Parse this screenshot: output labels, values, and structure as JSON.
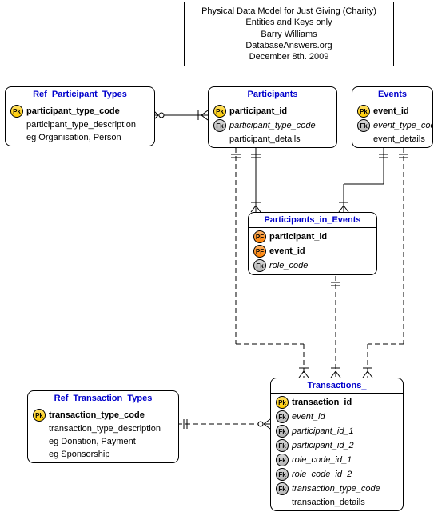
{
  "title_box": {
    "line1": "Physical Data Model for Just Giving (Charity)",
    "line2": "Entities and Keys only",
    "line3": "Barry Williams",
    "line4": "DatabaseAnswers.org",
    "line5": "December 8th. 2009"
  },
  "entities": {
    "ref_participant_types": {
      "title": "Ref_Participant_Types",
      "attrs": [
        {
          "key": "pk",
          "label": "Pk",
          "name": "participant_type_code",
          "bold": true
        },
        {
          "key": "",
          "name": "participant_type_description"
        },
        {
          "key": "",
          "name": "eg Organisation, Person"
        }
      ]
    },
    "participants": {
      "title": "Participants",
      "attrs": [
        {
          "key": "pk",
          "label": "Pk",
          "name": "participant_id",
          "bold": true
        },
        {
          "key": "fk",
          "label": "Fk",
          "name": "participant_type_code",
          "italic": true
        },
        {
          "key": "",
          "name": "participant_details"
        }
      ]
    },
    "events": {
      "title": "Events",
      "attrs": [
        {
          "key": "pk",
          "label": "Pk",
          "name": "event_id",
          "bold": true
        },
        {
          "key": "fk",
          "label": "Fk",
          "name": "event_type_code",
          "italic": true
        },
        {
          "key": "",
          "name": "event_details"
        }
      ]
    },
    "participants_in_events": {
      "title": "Participants_in_Events",
      "attrs": [
        {
          "key": "pf",
          "label": "PF",
          "name": "participant_id",
          "bold": true
        },
        {
          "key": "pf",
          "label": "PF",
          "name": "event_id",
          "bold": true
        },
        {
          "key": "fk",
          "label": "Fk",
          "name": "role_code",
          "italic": true
        }
      ]
    },
    "ref_transaction_types": {
      "title": "Ref_Transaction_Types",
      "attrs": [
        {
          "key": "pk",
          "label": "Pk",
          "name": "transaction_type_code",
          "bold": true
        },
        {
          "key": "",
          "name": "transaction_type_description"
        },
        {
          "key": "",
          "name": "eg Donation, Payment"
        },
        {
          "key": "",
          "name": "eg Sponsorship"
        }
      ]
    },
    "transactions": {
      "title": "Transactions_",
      "attrs": [
        {
          "key": "pk",
          "label": "Pk",
          "name": "transaction_id",
          "bold": true
        },
        {
          "key": "fk",
          "label": "Fk",
          "name": "event_id",
          "italic": true
        },
        {
          "key": "fk",
          "label": "Fk",
          "name": "participant_id_1",
          "italic": true
        },
        {
          "key": "fk",
          "label": "Fk",
          "name": "participant_id_2",
          "italic": true
        },
        {
          "key": "fk",
          "label": "Fk",
          "name": "role_code_id_1",
          "italic": true
        },
        {
          "key": "fk",
          "label": "Fk",
          "name": "role_code_id_2",
          "italic": true
        },
        {
          "key": "fk",
          "label": "Fk",
          "name": "transaction_type_code",
          "italic": true
        },
        {
          "key": "",
          "name": "transaction_details"
        }
      ]
    }
  },
  "chart_data": {
    "type": "table",
    "diagram_type": "physical-data-model",
    "title": "Physical Data Model for Just Giving (Charity) — Entities and Keys only",
    "author": "Barry Williams",
    "source": "DatabaseAnswers.org",
    "date": "December 8th. 2009",
    "entities": [
      {
        "name": "Ref_Participant_Types",
        "columns": [
          {
            "name": "participant_type_code",
            "key": "PK"
          },
          {
            "name": "participant_type_description"
          },
          {
            "name": "(example) Organisation, Person"
          }
        ]
      },
      {
        "name": "Participants",
        "columns": [
          {
            "name": "participant_id",
            "key": "PK"
          },
          {
            "name": "participant_type_code",
            "key": "FK"
          },
          {
            "name": "participant_details"
          }
        ]
      },
      {
        "name": "Events",
        "columns": [
          {
            "name": "event_id",
            "key": "PK"
          },
          {
            "name": "event_type_code",
            "key": "FK"
          },
          {
            "name": "event_details"
          }
        ]
      },
      {
        "name": "Participants_in_Events",
        "columns": [
          {
            "name": "participant_id",
            "key": "PK/FK"
          },
          {
            "name": "event_id",
            "key": "PK/FK"
          },
          {
            "name": "role_code",
            "key": "FK"
          }
        ]
      },
      {
        "name": "Ref_Transaction_Types",
        "columns": [
          {
            "name": "transaction_type_code",
            "key": "PK"
          },
          {
            "name": "transaction_type_description"
          },
          {
            "name": "(example) Donation, Payment"
          },
          {
            "name": "(example) Sponsorship"
          }
        ]
      },
      {
        "name": "Transactions_",
        "columns": [
          {
            "name": "transaction_id",
            "key": "PK"
          },
          {
            "name": "event_id",
            "key": "FK"
          },
          {
            "name": "participant_id_1",
            "key": "FK"
          },
          {
            "name": "participant_id_2",
            "key": "FK"
          },
          {
            "name": "role_code_id_1",
            "key": "FK"
          },
          {
            "name": "role_code_id_2",
            "key": "FK"
          },
          {
            "name": "transaction_type_code",
            "key": "FK"
          },
          {
            "name": "transaction_details"
          }
        ]
      }
    ],
    "relationships": [
      {
        "from": "Ref_Participant_Types",
        "to": "Participants",
        "type": "identifying one-to-many"
      },
      {
        "from": "Participants",
        "to": "Participants_in_Events",
        "type": "identifying one-to-many"
      },
      {
        "from": "Events",
        "to": "Participants_in_Events",
        "type": "identifying one-to-many"
      },
      {
        "from": "Participants",
        "to": "Transactions_",
        "type": "non-identifying one-to-many"
      },
      {
        "from": "Events",
        "to": "Transactions_",
        "type": "non-identifying one-to-many"
      },
      {
        "from": "Participants_in_Events",
        "to": "Transactions_",
        "type": "non-identifying one-to-many"
      },
      {
        "from": "Ref_Transaction_Types",
        "to": "Transactions_",
        "type": "non-identifying one-to-many"
      }
    ]
  }
}
